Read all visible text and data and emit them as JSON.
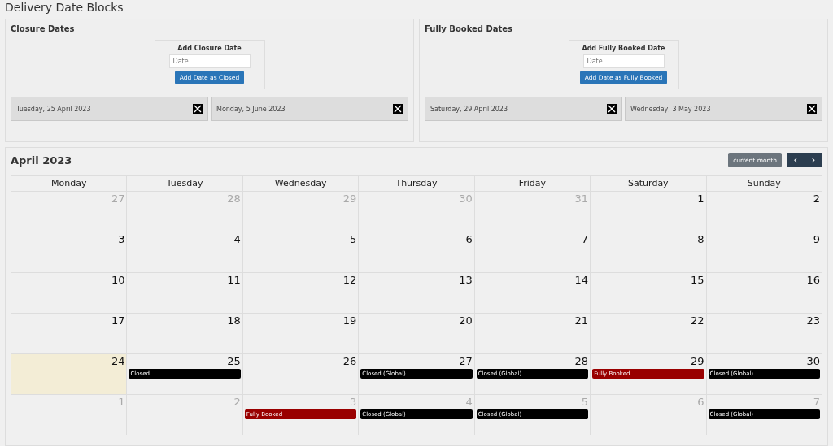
{
  "page_title": "Delivery Date Blocks",
  "panels": [
    {
      "title": "Closure Dates",
      "form_title": "Add Closure Date",
      "placeholder": "Date",
      "button": "Add Date as Closed",
      "dates": [
        "Tuesday, 25 April 2023",
        "Monday, 5 June 2023"
      ]
    },
    {
      "title": "Fully Booked Dates",
      "form_title": "Add Fully Booked Date",
      "placeholder": "Date",
      "button": "Add Date as Fully Booked",
      "dates": [
        "Saturday, 29 April 2023",
        "Wednesday, 3 May 2023"
      ]
    }
  ],
  "calendar": {
    "title": "April 2023",
    "current_button": "current month",
    "prev": "‹",
    "next": "›",
    "weekdays": [
      "Monday",
      "Tuesday",
      "Wednesday",
      "Thursday",
      "Friday",
      "Saturday",
      "Sunday"
    ],
    "weeks": [
      [
        {
          "day": "27",
          "muted": true,
          "highlighted": false
        },
        {
          "day": "28",
          "muted": true,
          "highlighted": false
        },
        {
          "day": "29",
          "muted": true,
          "highlighted": false
        },
        {
          "day": "30",
          "muted": true,
          "highlighted": false
        },
        {
          "day": "31",
          "muted": true,
          "highlighted": false
        },
        {
          "day": "1",
          "muted": false,
          "highlighted": false
        },
        {
          "day": "2",
          "muted": false,
          "highlighted": false
        }
      ],
      [
        {
          "day": "3",
          "muted": false,
          "highlighted": false
        },
        {
          "day": "4",
          "muted": false,
          "highlighted": false
        },
        {
          "day": "5",
          "muted": false,
          "highlighted": false
        },
        {
          "day": "6",
          "muted": false,
          "highlighted": false
        },
        {
          "day": "7",
          "muted": false,
          "highlighted": false
        },
        {
          "day": "8",
          "muted": false,
          "highlighted": false
        },
        {
          "day": "9",
          "muted": false,
          "highlighted": false
        }
      ],
      [
        {
          "day": "10",
          "muted": false,
          "highlighted": false
        },
        {
          "day": "11",
          "muted": false,
          "highlighted": false
        },
        {
          "day": "12",
          "muted": false,
          "highlighted": false
        },
        {
          "day": "13",
          "muted": false,
          "highlighted": false
        },
        {
          "day": "14",
          "muted": false,
          "highlighted": false
        },
        {
          "day": "15",
          "muted": false,
          "highlighted": false
        },
        {
          "day": "16",
          "muted": false,
          "highlighted": false
        }
      ],
      [
        {
          "day": "17",
          "muted": false,
          "highlighted": false
        },
        {
          "day": "18",
          "muted": false,
          "highlighted": false
        },
        {
          "day": "19",
          "muted": false,
          "highlighted": false
        },
        {
          "day": "20",
          "muted": false,
          "highlighted": false
        },
        {
          "day": "21",
          "muted": false,
          "highlighted": false
        },
        {
          "day": "22",
          "muted": false,
          "highlighted": false
        },
        {
          "day": "23",
          "muted": false,
          "highlighted": false
        }
      ],
      [
        {
          "day": "24",
          "muted": false,
          "highlighted": true
        },
        {
          "day": "25",
          "muted": false,
          "highlighted": false,
          "events": [
            {
              "label": "Closed",
              "color": "#000000"
            }
          ]
        },
        {
          "day": "26",
          "muted": false,
          "highlighted": false
        },
        {
          "day": "27",
          "muted": false,
          "highlighted": false,
          "events": [
            {
              "label": "Closed (Global)",
              "color": "#000000"
            }
          ]
        },
        {
          "day": "28",
          "muted": false,
          "highlighted": false,
          "events": [
            {
              "label": "Closed (Global)",
              "color": "#000000"
            }
          ]
        },
        {
          "day": "29",
          "muted": false,
          "highlighted": false,
          "events": [
            {
              "label": "Fully Booked",
              "color": "#990000"
            }
          ]
        },
        {
          "day": "30",
          "muted": false,
          "highlighted": false,
          "events": [
            {
              "label": "Closed (Global)",
              "color": "#000000"
            }
          ]
        }
      ],
      [
        {
          "day": "1",
          "muted": true,
          "highlighted": false
        },
        {
          "day": "2",
          "muted": true,
          "highlighted": false
        },
        {
          "day": "3",
          "muted": true,
          "highlighted": false,
          "events": [
            {
              "label": "Fully Booked",
              "color": "#990000"
            }
          ]
        },
        {
          "day": "4",
          "muted": true,
          "highlighted": false,
          "events": [
            {
              "label": "Closed (Global)",
              "color": "#000000"
            }
          ]
        },
        {
          "day": "5",
          "muted": true,
          "highlighted": false,
          "events": [
            {
              "label": "Closed (Global)",
              "color": "#000000"
            }
          ]
        },
        {
          "day": "6",
          "muted": true,
          "highlighted": false
        },
        {
          "day": "7",
          "muted": true,
          "highlighted": false,
          "events": [
            {
              "label": "Closed (Global)",
              "color": "#000000"
            }
          ]
        }
      ]
    ]
  }
}
